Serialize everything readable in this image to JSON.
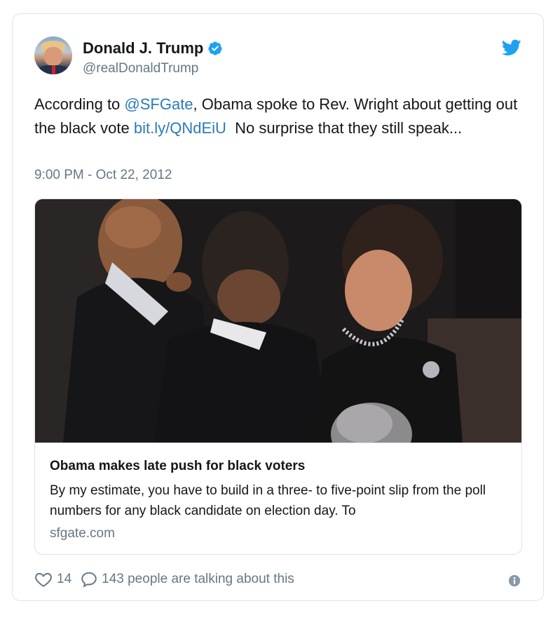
{
  "tweet": {
    "author_name": "Donald J. Trump",
    "handle": "@realDonaldTrump",
    "text_1": "According to ",
    "mention": "@SFGate",
    "text_2": ", Obama spoke to Rev. Wright about getting out the black vote ",
    "link": "bit.ly/QNdEiU",
    "text_3": "  No surprise that they still speak...",
    "timestamp": "9:00 PM - Oct 22, 2012"
  },
  "link_card": {
    "title": "Obama makes late push for black voters",
    "description": "By my estimate, you have to build in a three- to five-point slip from the poll numbers for any black candidate on election day. To",
    "domain": "sfgate.com"
  },
  "footer": {
    "like_count": "14",
    "talk_text": "143 people are talking about this"
  },
  "icons": {
    "verified": "verified-badge-icon",
    "bird": "twitter-bird-icon",
    "like": "heart-icon",
    "reply": "speech-bubble-icon",
    "info": "info-icon"
  },
  "colors": {
    "link": "#2b7bb9",
    "twitter_blue": "#1da1f2",
    "muted": "#657786",
    "border": "#dfe3e6"
  }
}
